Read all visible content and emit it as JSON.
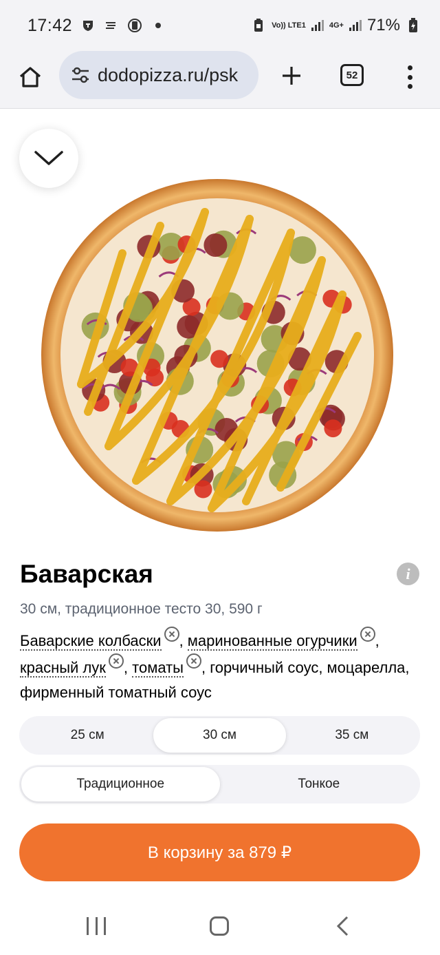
{
  "status": {
    "time": "17:42",
    "network1": "Vo)) LTE1",
    "network2": "4G+",
    "battery": "71%"
  },
  "browser": {
    "url": "dodopizza.ru/psk",
    "tab_count": "52"
  },
  "product": {
    "title": "Баварская",
    "meta": "30 см, традиционное тесто 30, 590 г",
    "ingredients_removable": [
      "Баварские колбаски",
      "маринованные огурчики",
      "красный лук",
      "томаты"
    ],
    "ingredients_rest": "горчичный соус, моцарелла, фирменный томатный соус",
    "sep": ", "
  },
  "sizes": [
    "25 см",
    "30 см",
    "35 см"
  ],
  "selected_size": "30 см",
  "dough": [
    "Традиционное",
    "Тонкое"
  ],
  "selected_dough": "Традиционное",
  "cart_button": "В корзину за 879 ₽",
  "colors": {
    "accent": "#f0732e",
    "segment_bg": "#f3f3f7",
    "url_pill": "#dfe3ee"
  }
}
